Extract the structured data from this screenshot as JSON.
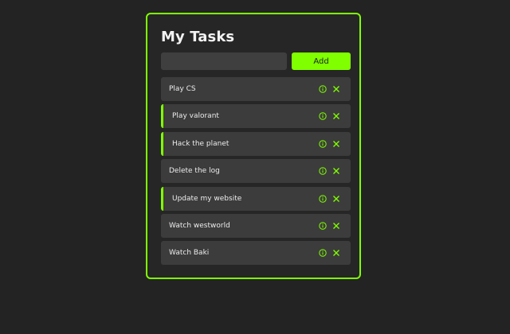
{
  "app": {
    "title": "My Tasks"
  },
  "form": {
    "input_value": "",
    "input_placeholder": "",
    "add_label": "Add"
  },
  "tasks": [
    {
      "label": "Play CS",
      "highlighted": false
    },
    {
      "label": "Play valorant",
      "highlighted": true
    },
    {
      "label": "Hack the planet",
      "highlighted": true
    },
    {
      "label": "Delete the log",
      "highlighted": false
    },
    {
      "label": "Update my website",
      "highlighted": true
    },
    {
      "label": "Watch westworld",
      "highlighted": false
    },
    {
      "label": "Watch Baki",
      "highlighted": false
    }
  ],
  "icons": {
    "info": "info-circle-icon",
    "delete": "close-icon"
  },
  "colors": {
    "background": "#232323",
    "card": "#262626",
    "accent": "#7fff00",
    "task_bg": "#3c3c3c",
    "input_bg": "#3f3f3f",
    "text": "#ececec"
  }
}
